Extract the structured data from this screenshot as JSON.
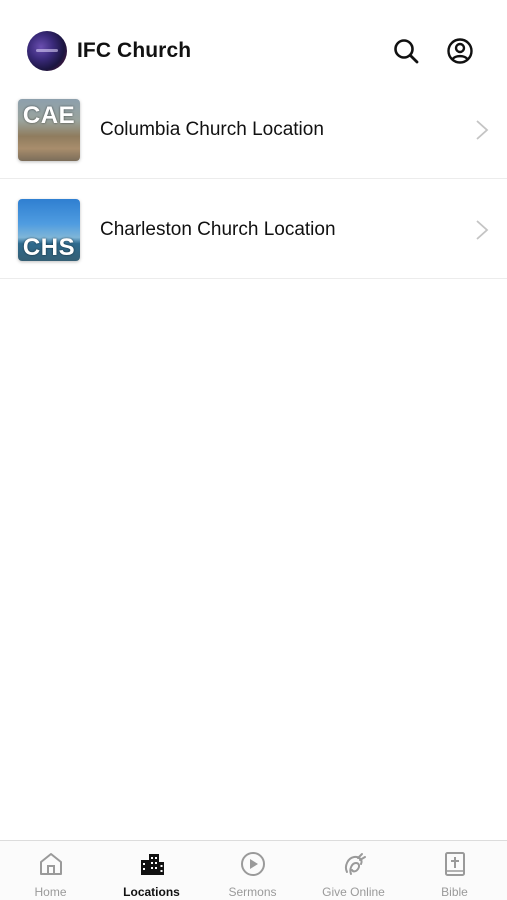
{
  "header": {
    "title": "IFC Church",
    "logo_icon": "church-logo",
    "search_icon": "search-icon",
    "account_icon": "account-circle-icon"
  },
  "locations": [
    {
      "code": "CAE",
      "label": "Columbia Church Location",
      "chevron_icon": "chevron-right-icon"
    },
    {
      "code": "CHS",
      "label": "Charleston Church Location",
      "chevron_icon": "chevron-right-icon"
    }
  ],
  "tabbar": {
    "active": "Locations",
    "tabs": [
      {
        "label": "Home",
        "icon": "home-icon"
      },
      {
        "label": "Locations",
        "icon": "buildings-icon"
      },
      {
        "label": "Sermons",
        "icon": "play-circle-icon"
      },
      {
        "label": "Give Online",
        "icon": "give-icon"
      },
      {
        "label": "Bible",
        "icon": "bible-icon"
      }
    ]
  },
  "colors": {
    "text": "#111111",
    "tab_inactive": "#9a9a9a",
    "divider": "#ececec"
  }
}
